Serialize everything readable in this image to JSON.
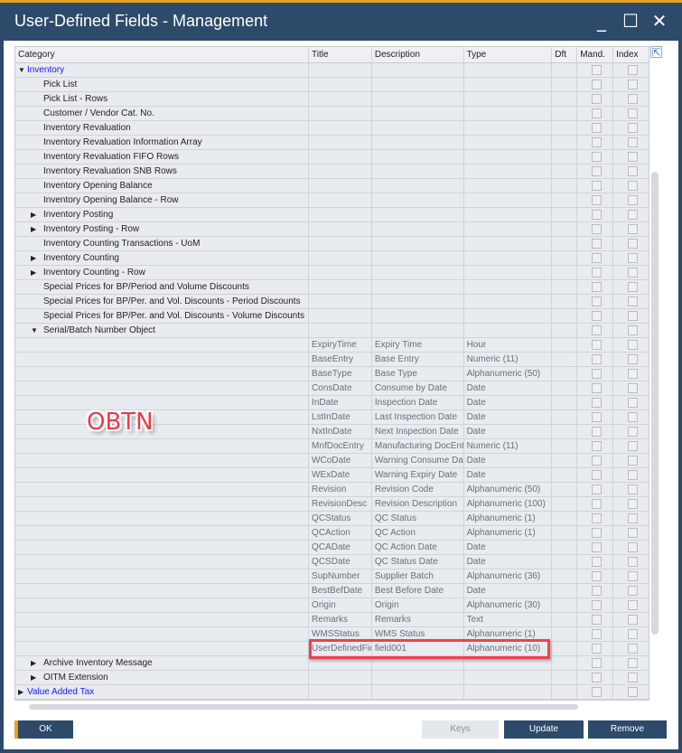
{
  "window": {
    "title": "User-Defined Fields - Management",
    "minimize": "_",
    "maximize": "☐",
    "close": "✕"
  },
  "columns": [
    "Category",
    "Title",
    "Description",
    "Type",
    "Dft",
    "Mand.",
    "Index"
  ],
  "rows": [
    {
      "cat": "Inventory",
      "level": 0,
      "toggle": "expanded",
      "link": true
    },
    {
      "cat": "Pick List",
      "level": 1
    },
    {
      "cat": "Pick List - Rows",
      "level": 1
    },
    {
      "cat": "Customer / Vendor Cat. No.",
      "level": 1
    },
    {
      "cat": "Inventory Revaluation",
      "level": 1
    },
    {
      "cat": "Inventory Revaluation Information Array",
      "level": 1
    },
    {
      "cat": "Inventory Revaluation FIFO Rows",
      "level": 1
    },
    {
      "cat": "Inventory Revaluation SNB Rows",
      "level": 1
    },
    {
      "cat": "Inventory Opening Balance",
      "level": 1
    },
    {
      "cat": "Inventory Opening Balance - Row",
      "level": 1
    },
    {
      "cat": "Inventory Posting",
      "level": 1,
      "toggle": "collapsed"
    },
    {
      "cat": "Inventory Posting - Row",
      "level": 1,
      "toggle": "collapsed"
    },
    {
      "cat": "Inventory Counting Transactions - UoM",
      "level": 1
    },
    {
      "cat": "Inventory Counting",
      "level": 1,
      "toggle": "collapsed"
    },
    {
      "cat": "Inventory Counting - Row",
      "level": 1,
      "toggle": "collapsed"
    },
    {
      "cat": "Special Prices for BP/Period and Volume Discounts",
      "level": 1
    },
    {
      "cat": "Special Prices for BP/Per. and Vol. Discounts - Period Discounts",
      "level": 1
    },
    {
      "cat": "Special Prices for BP/Per. and Vol. Discounts - Volume Discounts",
      "level": 1
    },
    {
      "cat": "Serial/Batch Number Object",
      "level": 1,
      "toggle": "expanded"
    },
    {
      "title": "ExpiryTime",
      "desc": "Expiry Time",
      "type": "Hour"
    },
    {
      "title": "BaseEntry",
      "desc": "Base Entry",
      "type": "Numeric (11)"
    },
    {
      "title": "BaseType",
      "desc": "Base Type",
      "type": "Alphanumeric (50)"
    },
    {
      "title": "ConsDate",
      "desc": "Consume by Date",
      "type": "Date"
    },
    {
      "title": "InDate",
      "desc": "Inspection Date",
      "type": "Date"
    },
    {
      "title": "LstInDate",
      "desc": "Last Inspection Date",
      "type": "Date"
    },
    {
      "title": "NxtInDate",
      "desc": "Next Inspection Date",
      "type": "Date"
    },
    {
      "title": "MnfDocEntry",
      "desc": "Manufacturing DocEntry",
      "type": "Numeric (11)"
    },
    {
      "title": "WCoDate",
      "desc": "Warning Consume Date",
      "type": "Date"
    },
    {
      "title": "WExDate",
      "desc": "Warning Expiry Date",
      "type": "Date"
    },
    {
      "title": "Revision",
      "desc": "Revision Code",
      "type": "Alphanumeric (50)"
    },
    {
      "title": "RevisionDesc",
      "desc": "Revision Description",
      "type": "Alphanumeric (100)"
    },
    {
      "title": "QCStatus",
      "desc": "QC Status",
      "type": "Alphanumeric (1)"
    },
    {
      "title": "QCAction",
      "desc": "QC Action",
      "type": "Alphanumeric (1)"
    },
    {
      "title": "QCADate",
      "desc": "QC Action Date",
      "type": "Date"
    },
    {
      "title": "QCSDate",
      "desc": "QC Status Date",
      "type": "Date"
    },
    {
      "title": "SupNumber",
      "desc": "Supplier Batch",
      "type": "Alphanumeric (36)"
    },
    {
      "title": "BestBefDate",
      "desc": "Best Before Date",
      "type": "Date"
    },
    {
      "title": "Origin",
      "desc": "Origin",
      "type": "Alphanumeric (30)"
    },
    {
      "title": "Remarks",
      "desc": "Remarks",
      "type": "Text"
    },
    {
      "title": "WMSStatus",
      "desc": "WMS Status",
      "type": "Alphanumeric (1)"
    },
    {
      "title": "UserDefinedFie",
      "desc": "field001",
      "type": "Alphanumeric (10)"
    },
    {
      "cat": "Archive Inventory Message",
      "level": 1,
      "toggle": "collapsed"
    },
    {
      "cat": "OITM Extension",
      "level": 1,
      "toggle": "collapsed"
    },
    {
      "cat": "Value Added Tax",
      "level": 0,
      "toggle": "collapsed",
      "link": true
    }
  ],
  "annotation": {
    "label": "OBTN",
    "color": "#f03848"
  },
  "buttons": {
    "ok": "OK",
    "keys": "Keys",
    "update": "Update",
    "remove": "Remove"
  },
  "colors": {
    "titlebar": "#2d4a6b",
    "accent": "#e6a020",
    "highlight": "#f04050"
  }
}
